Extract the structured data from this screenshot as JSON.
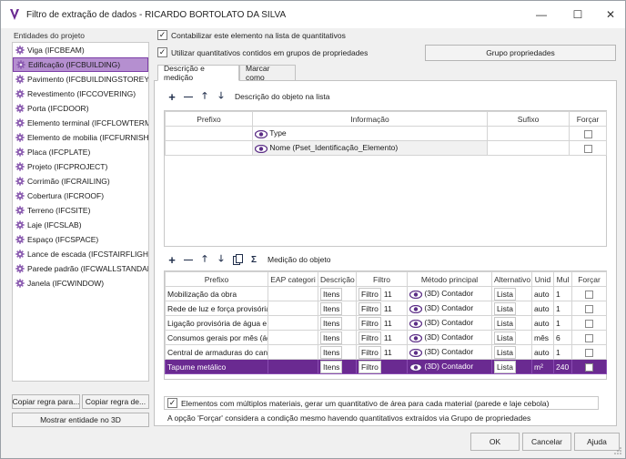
{
  "window": {
    "title": "Filtro de extração de dados - RICARDO BORTOLATO DA SILVA",
    "minimize_glyph": "—",
    "maximize_glyph": "☐",
    "close_glyph": "✕",
    "accent_color": "#6a2a91"
  },
  "sidebar": {
    "title": "Entidades do projeto",
    "items": [
      {
        "label": "Viga (IFCBEAM)"
      },
      {
        "label": "Edificação (IFCBUILDING)",
        "selected": true
      },
      {
        "label": "Pavimento (IFCBUILDINGSTOREY)"
      },
      {
        "label": "Revestimento (IFCCOVERING)"
      },
      {
        "label": "Porta (IFCDOOR)"
      },
      {
        "label": "Elemento terminal (IFCFLOWTERMIN"
      },
      {
        "label": "Elemento de mobilia (IFCFURNISHIN"
      },
      {
        "label": "Placa (IFCPLATE)"
      },
      {
        "label": "Projeto (IFCPROJECT)"
      },
      {
        "label": "Corrimão (IFCRAILING)"
      },
      {
        "label": "Cobertura (IFCROOF)"
      },
      {
        "label": "Terreno (IFCSITE)"
      },
      {
        "label": "Laje (IFCSLAB)"
      },
      {
        "label": "Espaço (IFCSPACE)"
      },
      {
        "label": "Lance de escada (IFCSTAIRFLIGHT)"
      },
      {
        "label": "Parede padrão (IFCWALLSTANDARD"
      },
      {
        "label": "Janela (IFCWINDOW)"
      }
    ],
    "copy_rule_to_button": "Copiar regra para...",
    "copy_rule_from_button": "Copiar regra de...",
    "show_entity_3d_button": "Mostrar entidade no 3D"
  },
  "options": {
    "count_element_label": "Contabilizar este elemento na lista de quantitativos",
    "count_element_checked": true,
    "use_property_groups_label": "Utilizar quantitativos contidos em grupos de propriedades",
    "use_property_groups_checked": true,
    "property_group_button": "Grupo propriedades"
  },
  "tabs": [
    {
      "label": "Descrição e medição",
      "active": true
    },
    {
      "label": "Marcar como",
      "active": false
    }
  ],
  "description": {
    "toolbar": {
      "add": "+",
      "remove": "—",
      "up": "🡑",
      "down": "🡓",
      "label": "Descrição do objeto na lista"
    },
    "columns": [
      "Prefixo",
      "Informação",
      "Sufixo",
      "Forçar"
    ],
    "rows": [
      {
        "prefix": "",
        "info": "Type",
        "suffix": "",
        "force": false
      },
      {
        "prefix": "",
        "info": "Nome (Pset_Identificação_Elemento)",
        "suffix": "",
        "force": false
      }
    ]
  },
  "measurement": {
    "toolbar": {
      "add": "+",
      "remove": "—",
      "up": "🡑",
      "down": "🡓",
      "sum": "Σ",
      "label": "Medição do objeto"
    },
    "columns": [
      "Prefixo",
      "EAP categori",
      "Descrição",
      "Filtro",
      "Método principal",
      "Alternativo",
      "Unid",
      "Mul",
      "Forçar"
    ],
    "rows": [
      {
        "prefix": "Mobilização da obra",
        "eap": "",
        "desc": "Itens",
        "filter": "Filtro",
        "filter_num": "11",
        "method": "(3D) Contador",
        "alt": "Lista",
        "unit": "auto",
        "mul": "1",
        "force": false,
        "highlight": false
      },
      {
        "prefix": "Rede de luz e força provisória:",
        "eap": "",
        "desc": "Itens",
        "filter": "Filtro",
        "filter_num": "11",
        "method": "(3D) Contador",
        "alt": "Lista",
        "unit": "auto",
        "mul": "1",
        "force": false,
        "highlight": false
      },
      {
        "prefix": "Ligação provisória de água e e",
        "eap": "",
        "desc": "Itens",
        "filter": "Filtro",
        "filter_num": "11",
        "method": "(3D) Contador",
        "alt": "Lista",
        "unit": "auto",
        "mul": "1",
        "force": false,
        "highlight": false
      },
      {
        "prefix": "Consumos gerais por mês (águ",
        "eap": "",
        "desc": "Itens",
        "filter": "Filtro",
        "filter_num": "11",
        "method": "(3D) Contador",
        "alt": "Lista",
        "unit": "mês",
        "mul": "6",
        "force": false,
        "highlight": false
      },
      {
        "prefix": "Central de armaduras do cante",
        "eap": "",
        "desc": "Itens",
        "filter": "Filtro",
        "filter_num": "11",
        "method": "(3D) Contador",
        "alt": "Lista",
        "unit": "auto",
        "mul": "1",
        "force": false,
        "highlight": false
      },
      {
        "prefix": "Tapume metálico",
        "eap": "",
        "desc": "Itens",
        "filter": "Filtro",
        "filter_num": "",
        "method": "(3D) Contador",
        "alt": "Lista",
        "unit": "m²",
        "mul": "240",
        "force": false,
        "highlight": true
      }
    ]
  },
  "multi_material": {
    "label": "Elementos com múltiplos materiais, gerar um quantitativo de área para cada material (parede e laje cebola)",
    "checked": true
  },
  "force_note": "A opção 'Forçar' considera a condição mesmo havendo quantitativos extraídos via Grupo de propriedades",
  "footer": {
    "ok": "OK",
    "cancel": "Cancelar",
    "help": "Ajuda"
  }
}
